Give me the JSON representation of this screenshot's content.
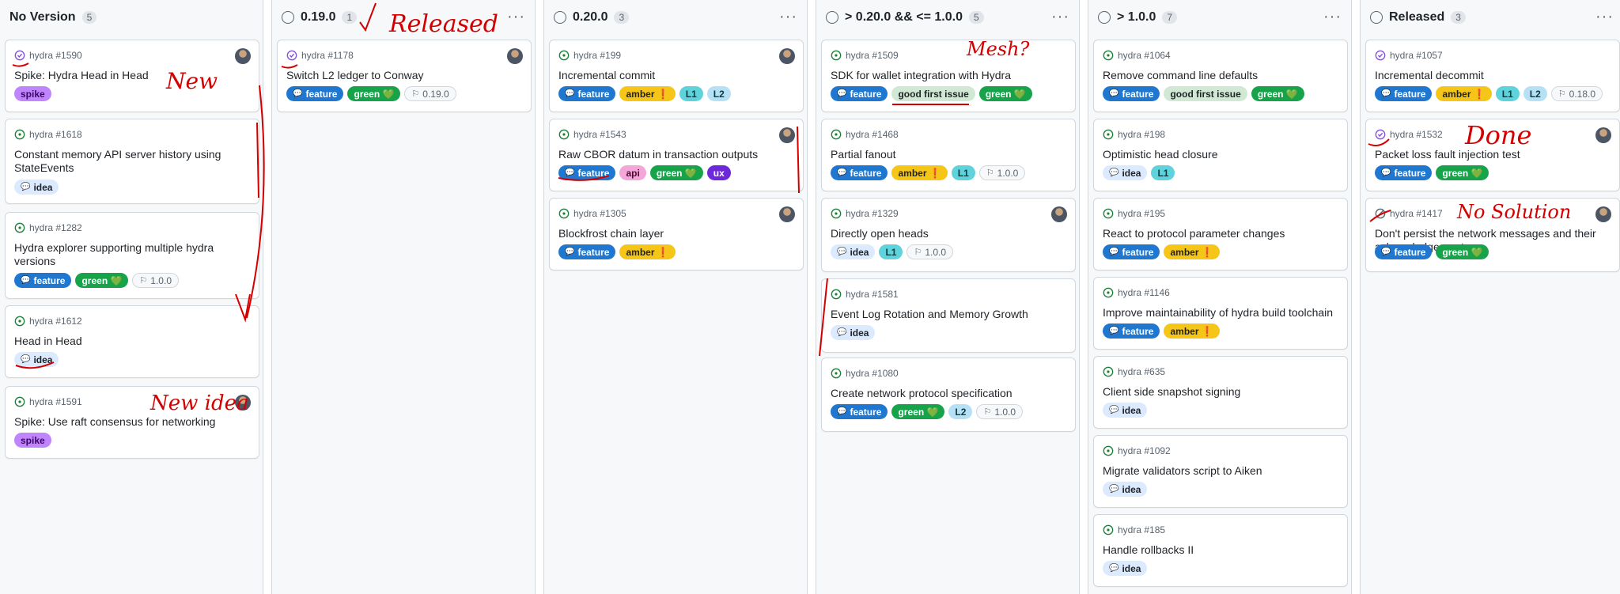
{
  "columns": [
    {
      "title": "No Version",
      "count": "5",
      "cards": [
        {
          "issue": "hydra #1590",
          "title": "Spike: Hydra Head in Head",
          "state": "closed",
          "avatar": true,
          "labels": [
            {
              "text": "spike",
              "kind": "spike"
            }
          ]
        },
        {
          "issue": "hydra #1618",
          "title": "Constant memory API server history using StateEvents",
          "state": "open",
          "avatar": false,
          "labels": [
            {
              "text": "idea",
              "kind": "idea"
            }
          ]
        },
        {
          "issue": "hydra #1282",
          "title": "Hydra explorer supporting multiple hydra versions",
          "state": "open",
          "avatar": false,
          "labels": [
            {
              "text": "feature",
              "kind": "feature"
            },
            {
              "text": "green 💚",
              "kind": "green"
            }
          ],
          "milestone": "1.0.0"
        },
        {
          "issue": "hydra #1612",
          "title": "Head in Head",
          "state": "open",
          "avatar": false,
          "labels": [
            {
              "text": "idea",
              "kind": "idea"
            }
          ]
        },
        {
          "issue": "hydra #1591",
          "title": "Spike: Use raft consensus for networking",
          "state": "open",
          "avatar": true,
          "labels": [
            {
              "text": "spike",
              "kind": "spike"
            }
          ]
        }
      ]
    },
    {
      "title": "0.19.0",
      "count": "1",
      "cards": [
        {
          "issue": "hydra #1178",
          "title": "Switch L2 ledger to Conway",
          "state": "closed",
          "avatar": true,
          "labels": [
            {
              "text": "feature",
              "kind": "feature"
            },
            {
              "text": "green 💚",
              "kind": "green"
            }
          ],
          "milestone": "0.19.0"
        }
      ]
    },
    {
      "title": "0.20.0",
      "count": "3",
      "cards": [
        {
          "issue": "hydra #199",
          "title": "Incremental commit",
          "state": "open",
          "avatar": true,
          "labels": [
            {
              "text": "feature",
              "kind": "feature"
            },
            {
              "text": "amber ❗",
              "kind": "amber"
            },
            {
              "text": "L1",
              "kind": "l1"
            },
            {
              "text": "L2",
              "kind": "l2"
            }
          ]
        },
        {
          "issue": "hydra #1543",
          "title": "Raw CBOR datum in transaction outputs",
          "state": "open",
          "avatar": true,
          "labels": [
            {
              "text": "feature",
              "kind": "feature"
            },
            {
              "text": "api",
              "kind": "api"
            },
            {
              "text": "green 💚",
              "kind": "green"
            },
            {
              "text": "ux",
              "kind": "ux"
            }
          ]
        },
        {
          "issue": "hydra #1305",
          "title": "Blockfrost chain layer",
          "state": "open",
          "avatar": true,
          "labels": [
            {
              "text": "feature",
              "kind": "feature"
            },
            {
              "text": "amber ❗",
              "kind": "amber"
            }
          ]
        }
      ]
    },
    {
      "title": "> 0.20.0 && <= 1.0.0",
      "count": "5",
      "cards": [
        {
          "issue": "hydra #1509",
          "title": "SDK for wallet integration with Hydra",
          "state": "open",
          "avatar": false,
          "labels": [
            {
              "text": "feature",
              "kind": "feature"
            },
            {
              "text": "good first issue",
              "kind": "gfi"
            },
            {
              "text": "green 💚",
              "kind": "green"
            }
          ]
        },
        {
          "issue": "hydra #1468",
          "title": "Partial fanout",
          "state": "open",
          "avatar": false,
          "labels": [
            {
              "text": "feature",
              "kind": "feature"
            },
            {
              "text": "amber ❗",
              "kind": "amber"
            },
            {
              "text": "L1",
              "kind": "l1"
            }
          ],
          "milestone": "1.0.0"
        },
        {
          "issue": "hydra #1329",
          "title": "Directly open heads",
          "state": "open",
          "avatar": true,
          "labels": [
            {
              "text": "idea",
              "kind": "idea"
            },
            {
              "text": "L1",
              "kind": "l1"
            }
          ],
          "milestone": "1.0.0"
        },
        {
          "issue": "hydra #1581",
          "title": "Event Log Rotation and Memory Growth",
          "state": "open",
          "avatar": false,
          "labels": [
            {
              "text": "idea",
              "kind": "idea"
            }
          ]
        },
        {
          "issue": "hydra #1080",
          "title": "Create network protocol specification",
          "state": "open",
          "avatar": false,
          "labels": [
            {
              "text": "feature",
              "kind": "feature"
            },
            {
              "text": "green 💚",
              "kind": "green"
            },
            {
              "text": "L2",
              "kind": "l2"
            }
          ],
          "milestone": "1.0.0"
        }
      ]
    },
    {
      "title": "> 1.0.0",
      "count": "7",
      "cards": [
        {
          "issue": "hydra #1064",
          "title": "Remove command line defaults",
          "state": "open",
          "avatar": false,
          "labels": [
            {
              "text": "feature",
              "kind": "feature"
            },
            {
              "text": "good first issue",
              "kind": "gfi"
            },
            {
              "text": "green 💚",
              "kind": "green"
            }
          ]
        },
        {
          "issue": "hydra #198",
          "title": "Optimistic head closure",
          "state": "open",
          "avatar": false,
          "labels": [
            {
              "text": "idea",
              "kind": "idea"
            },
            {
              "text": "L1",
              "kind": "l1"
            }
          ]
        },
        {
          "issue": "hydra #195",
          "title": "React to protocol parameter changes",
          "state": "open",
          "avatar": false,
          "labels": [
            {
              "text": "feature",
              "kind": "feature"
            },
            {
              "text": "amber ❗",
              "kind": "amber"
            }
          ]
        },
        {
          "issue": "hydra #1146",
          "title": "Improve maintainability of hydra build toolchain",
          "state": "open",
          "avatar": false,
          "labels": [
            {
              "text": "feature",
              "kind": "feature"
            },
            {
              "text": "amber ❗",
              "kind": "amber"
            }
          ]
        },
        {
          "issue": "hydra #635",
          "title": "Client side snapshot signing",
          "state": "open",
          "avatar": false,
          "labels": [
            {
              "text": "idea",
              "kind": "idea"
            }
          ]
        },
        {
          "issue": "hydra #1092",
          "title": "Migrate validators script to Aiken",
          "state": "open",
          "avatar": false,
          "labels": [
            {
              "text": "idea",
              "kind": "idea"
            }
          ]
        },
        {
          "issue": "hydra #185",
          "title": "Handle rollbacks II",
          "state": "open",
          "avatar": false,
          "labels": [
            {
              "text": "idea",
              "kind": "idea"
            }
          ]
        }
      ]
    },
    {
      "title": "Released",
      "count": "3",
      "cards": [
        {
          "issue": "hydra #1057",
          "title": "Incremental decommit",
          "state": "closed",
          "avatar": false,
          "labels": [
            {
              "text": "feature",
              "kind": "feature"
            },
            {
              "text": "amber ❗",
              "kind": "amber"
            },
            {
              "text": "L1",
              "kind": "l1"
            },
            {
              "text": "L2",
              "kind": "l2"
            }
          ],
          "milestone": "0.18.0"
        },
        {
          "issue": "hydra #1532",
          "title": "Packet loss fault injection test",
          "state": "closed",
          "avatar": true,
          "labels": [
            {
              "text": "feature",
              "kind": "feature"
            },
            {
              "text": "green 💚",
              "kind": "green"
            }
          ]
        },
        {
          "issue": "hydra #1417",
          "title": "Don't persist the network messages and their acknowledgements",
          "state": "not-planned",
          "avatar": true,
          "labels": [
            {
              "text": "feature",
              "kind": "feature"
            },
            {
              "text": "green 💚",
              "kind": "green"
            }
          ]
        }
      ]
    }
  ],
  "annotations": {
    "released": "Released",
    "new": "New",
    "new_idea": "New idea",
    "mesh": "Mesh?",
    "done": "Done",
    "no_solution": "No Solution"
  },
  "colors": {
    "accent_blue": "#1f77d0",
    "open_green": "#1a7f37",
    "closed_purple": "#8250df",
    "ink_red": "#d40000"
  }
}
